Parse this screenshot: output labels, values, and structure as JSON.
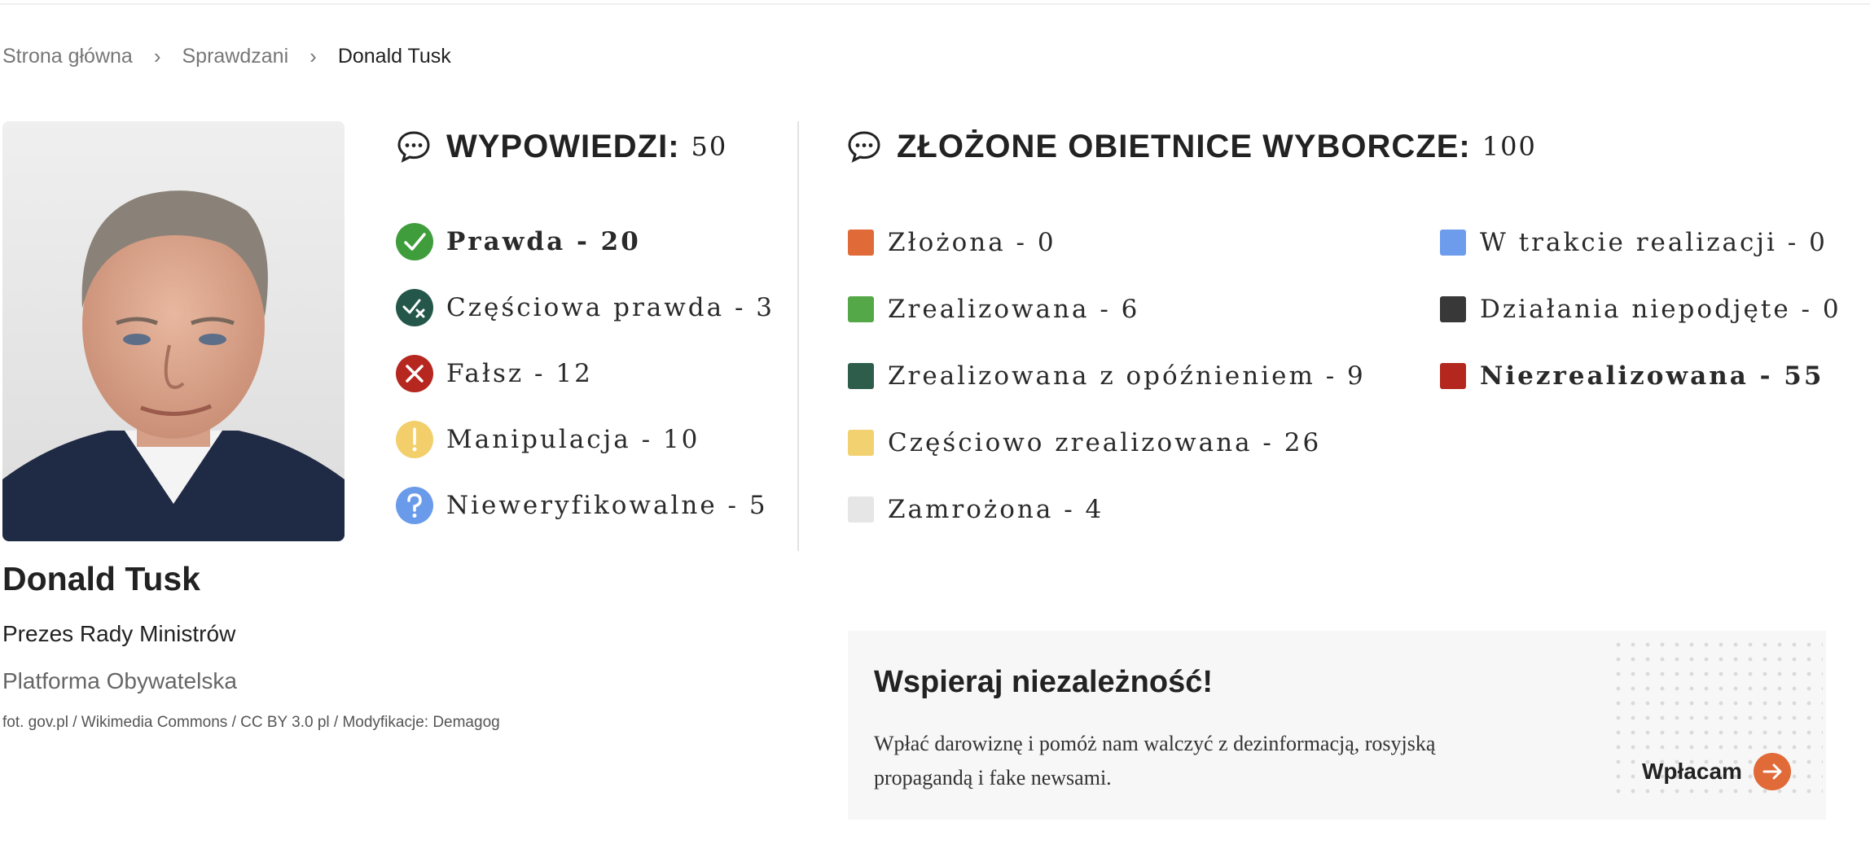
{
  "breadcrumb": {
    "home": "Strona główna",
    "section": "Sprawdzani",
    "current": "Donald Tusk",
    "separator": "›"
  },
  "person": {
    "name": "Donald Tusk",
    "role": "Prezes Rady Ministrów",
    "party": "Platforma Obywatelska",
    "photo_credit": "fot. gov.pl / Wikimedia Commons / CC BY 3.0 pl / Modyfikacje: Demagog"
  },
  "statements": {
    "title": "WYPOWIEDZI:",
    "count": "50",
    "icon": "speech-bubble-icon",
    "items": [
      {
        "label": "Prawda - 20",
        "icon": "check-icon",
        "color": "#3f9d3b"
      },
      {
        "label": "Częściowa prawda - 3",
        "icon": "partial-check-icon",
        "color": "#24574a"
      },
      {
        "label": "Fałsz - 12",
        "icon": "x-icon",
        "color": "#b5271f"
      },
      {
        "label": "Manipulacja - 10",
        "icon": "exclamation-icon",
        "color": "#f2cf6b"
      },
      {
        "label": "Nieweryfikowalne - 5",
        "icon": "question-icon",
        "color": "#6a9bea"
      }
    ]
  },
  "promises": {
    "title": "ZŁOŻONE OBIETNICE WYBORCZE:",
    "count": "100",
    "icon": "speech-bubble-icon",
    "items": [
      {
        "label": "Złożona - 0",
        "color": "#e06a38"
      },
      {
        "label": "Zrealizowana - 6",
        "color": "#55a847"
      },
      {
        "label": "Zrealizowana z opóźnieniem - 9",
        "color": "#2e5e4b"
      },
      {
        "label": "Częściowo zrealizowana - 26",
        "color": "#f1d170"
      },
      {
        "label": "Zamrożona - 4",
        "color": "#e6e6e6"
      },
      {
        "label": "W trakcie realizacji - 0",
        "color": "#6d9ced"
      },
      {
        "label": "Działania niepodjęte - 0",
        "color": "#383838"
      },
      {
        "label": "Niezrealizowana - 55",
        "color": "#b3271f"
      }
    ]
  },
  "support": {
    "title": "Wspieraj niezależność!",
    "text": "Wpłać darowiznę i pomóż nam walczyć z dezinformacją, rosyjską propagandą i fake newsami.",
    "button_label": "Wpłacam",
    "accent": "#e06a38"
  }
}
